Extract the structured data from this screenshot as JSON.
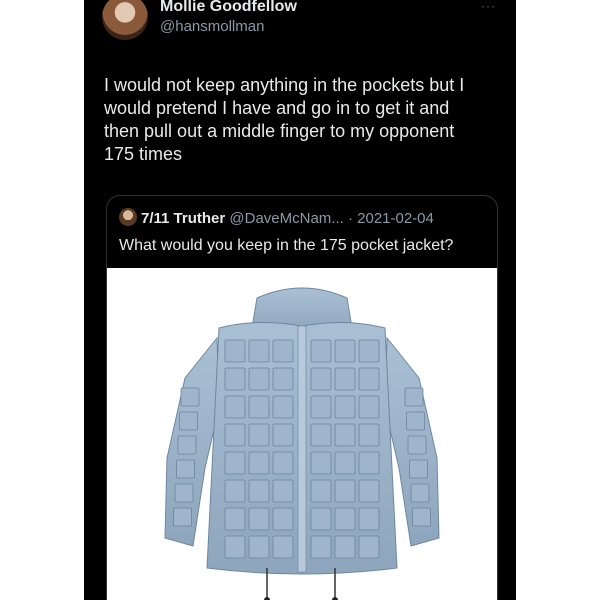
{
  "author": {
    "display_name": "Mollie Goodfellow",
    "handle": "@hansmollman",
    "avatar_icon": "user-avatar"
  },
  "more_icon": "···",
  "tweet_text": "I would not keep anything in the pockets but I\nwould pretend I have and go in to get it and\nthen pull out a middle finger to my opponent\n175 times",
  "quoted": {
    "display_name": "7/11 Truther",
    "handle_date": "@DaveMcNam... · 2021-02-04",
    "text": "What would you keep in the 175 pocket jacket?",
    "media": "jacket-photo"
  },
  "colors": {
    "background": "#000000",
    "text": "#e7e9ea",
    "secondary_text": "#8b98a5",
    "jacket": "#9db3c9"
  }
}
